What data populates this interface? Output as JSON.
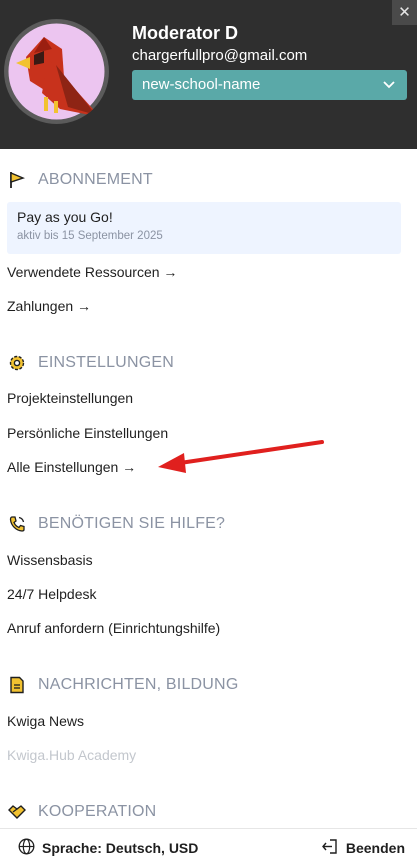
{
  "header": {
    "close_label": "✕",
    "user_name": "Moderator D",
    "user_email": "chargerfullpro@gmail.com",
    "school_select": {
      "value": "new-school-name"
    }
  },
  "sections": {
    "subscription": {
      "title": "ABONNEMENT",
      "plan_title": "Pay as you Go!",
      "plan_subtitle": "aktiv bis 15 September 2025",
      "links": [
        "Verwendete Ressourcen →",
        "Zahlungen →"
      ]
    },
    "settings": {
      "title": "EINSTELLUNGEN",
      "links": [
        "Projekteinstellungen",
        "Persönliche Einstellungen",
        "Alle Einstellungen →"
      ]
    },
    "help": {
      "title": "BENÖTIGEN SIE HILFE?",
      "links": [
        "Wissensbasis",
        "24/7 Helpdesk",
        "Anruf anfordern (Einrichtungshilfe)"
      ]
    },
    "news": {
      "title": "NACHRICHTEN, BILDUNG",
      "links": [
        "Kwiga News",
        "Kwiga.Hub Academy"
      ]
    },
    "cooperation": {
      "title": "KOOPERATION"
    }
  },
  "footer": {
    "language_label": "Sprache: Deutsch, USD",
    "logout_label": "Beenden"
  },
  "colors": {
    "header_bg": "#2f2f2f",
    "accent_teal": "#5aa9a8",
    "section_gray": "#8b93a3",
    "icon_yellow": "#f2c230",
    "annotation_red": "#e0201e"
  }
}
